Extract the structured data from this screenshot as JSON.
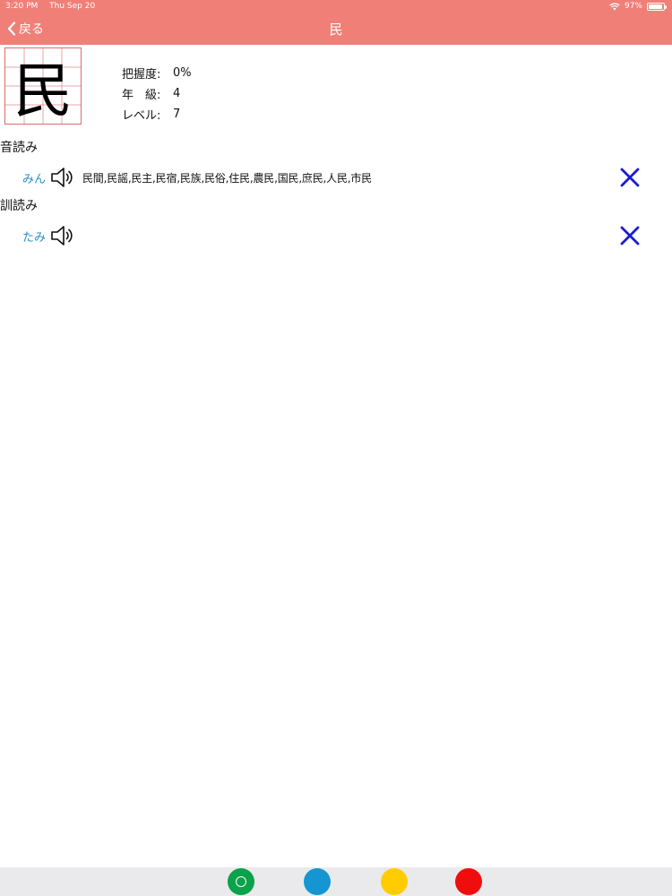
{
  "status": {
    "time": "3:20 PM",
    "date": "Thu Sep 20",
    "battery": "97%"
  },
  "nav": {
    "back_label": "戻る",
    "title": "民"
  },
  "kanji": {
    "character": "民"
  },
  "info": {
    "mastery_label": "把握度:",
    "mastery_value": "0%",
    "grade_label": "年　級:",
    "grade_value": "4",
    "level_label": "レベル:",
    "level_value": "7"
  },
  "on_reading": {
    "section_label": "音読み",
    "kana": "みん",
    "words": "民間,民謡,民主,民宿,民族,民俗,住民,農民,国民,庶民,人民,市民"
  },
  "kun_reading": {
    "section_label": "訓読み",
    "kana": "たみ",
    "words": ""
  },
  "colors": {
    "nav_bg": "#f07f78",
    "kana": "#2a8fc9",
    "close": "#1c1ccc",
    "green": "#0aa24a",
    "blue": "#1596d2",
    "yellow": "#ffcc00",
    "red": "#f00d0d"
  },
  "icons": {
    "back": "chevron-left-icon",
    "speaker": "speaker-icon",
    "close": "close-icon"
  }
}
